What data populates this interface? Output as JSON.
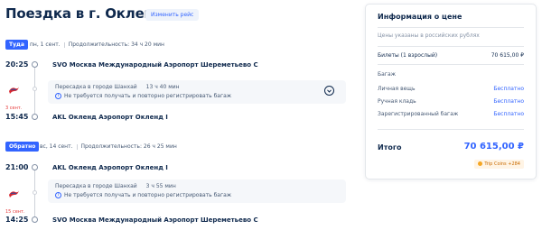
{
  "header": {
    "title": "Поездка в г. Окленд",
    "change_route": "Изменить рейс"
  },
  "outbound": {
    "badge": "Туда",
    "date": "пн, 1 сент.",
    "duration": "Продолжительность: 34 ч 20 мин",
    "dep_time": "20:25",
    "dep_airport": "SVO Москва Международный Аэропорт Шереметьево C",
    "layover_city": "Пересадка в городе Шанхай",
    "layover_duration": "13 ч 40 мин",
    "layover_note": "Не требуется получать и повторно регистрировать багаж",
    "arr_day": "3 сент.",
    "arr_time": "15:45",
    "arr_airport": "AKL Окленд Аэропорт Окленд I"
  },
  "inbound": {
    "badge": "Обратно",
    "date": "вс, 14 сент.",
    "duration": "Продолжительность: 26 ч 25 мин",
    "dep_time": "21:00",
    "dep_airport": "AKL Окленд Аэропорт Окленд I",
    "layover_city": "Пересадка в городе Шанхай",
    "layover_duration": "3 ч 55 мин",
    "layover_note": "Не требуется получать и повторно регистрировать багаж",
    "arr_day": "15 сент.",
    "arr_time": "14:25",
    "arr_airport": "SVO Москва Международный Аэропорт Шереметьево C"
  },
  "price_panel": {
    "title": "Информация о цене",
    "note": "Цены указаны в российских рублях",
    "tickets_label": "Билеты (1 взрослый)",
    "tickets_value": "70 615,00 ₽",
    "baggage_header": "Багаж",
    "baggage": [
      {
        "label": "Личная вещь",
        "value": "Бесплатно"
      },
      {
        "label": "Ручная кладь",
        "value": "Бесплатно"
      },
      {
        "label": "Зарегистрированный багаж",
        "value": "Бесплатно"
      }
    ],
    "total_label": "Итого",
    "total_value": "70 615,00 ₽",
    "coins": "Trip Coins +284"
  },
  "colors": {
    "accent": "#3264ff",
    "text": "#0f294d",
    "muted": "#8592a6",
    "airline_red": "#d8262f"
  },
  "icons": {
    "airline": "china-eastern-logo-icon",
    "info": "info-circle-icon",
    "expand": "chevron-down-icon",
    "coins": "trip-coins-icon"
  }
}
